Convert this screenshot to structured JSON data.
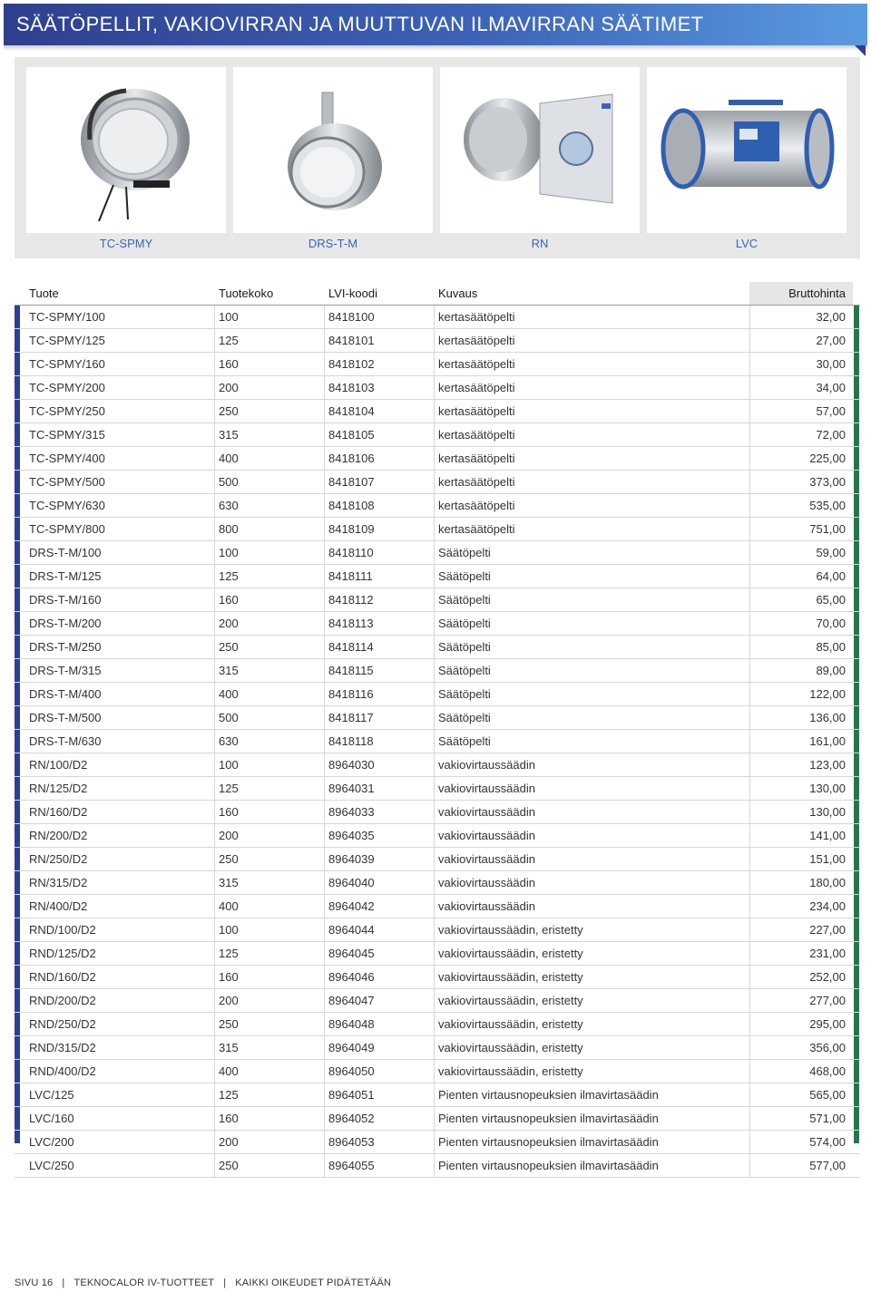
{
  "page": {
    "title": "SÄÄTÖPELLIT, VAKIOVIRRAN JA MUUTTUVAN ILMAVIRRAN SÄÄTIMET"
  },
  "products": [
    {
      "label": "TC-SPMY"
    },
    {
      "label": "DRS-T-M"
    },
    {
      "label": "RN"
    },
    {
      "label": "LVC"
    }
  ],
  "table": {
    "headers": [
      "Tuote",
      "Tuotekoko",
      "LVI-koodi",
      "Kuvaus",
      "Bruttohinta"
    ],
    "rows": [
      [
        "TC-SPMY/100",
        "100",
        "8418100",
        "kertasäätöpelti",
        "32,00"
      ],
      [
        "TC-SPMY/125",
        "125",
        "8418101",
        "kertasäätöpelti",
        "27,00"
      ],
      [
        "TC-SPMY/160",
        "160",
        "8418102",
        "kertasäätöpelti",
        "30,00"
      ],
      [
        "TC-SPMY/200",
        "200",
        "8418103",
        "kertasäätöpelti",
        "34,00"
      ],
      [
        "TC-SPMY/250",
        "250",
        "8418104",
        "kertasäätöpelti",
        "57,00"
      ],
      [
        "TC-SPMY/315",
        "315",
        "8418105",
        "kertasäätöpelti",
        "72,00"
      ],
      [
        "TC-SPMY/400",
        "400",
        "8418106",
        "kertasäätöpelti",
        "225,00"
      ],
      [
        "TC-SPMY/500",
        "500",
        "8418107",
        "kertasäätöpelti",
        "373,00"
      ],
      [
        "TC-SPMY/630",
        "630",
        "8418108",
        "kertasäätöpelti",
        "535,00"
      ],
      [
        "TC-SPMY/800",
        "800",
        "8418109",
        "kertasäätöpelti",
        "751,00"
      ],
      [
        "DRS-T-M/100",
        "100",
        "8418110",
        "Säätöpelti",
        "59,00"
      ],
      [
        "DRS-T-M/125",
        "125",
        "8418111",
        "Säätöpelti",
        "64,00"
      ],
      [
        "DRS-T-M/160",
        "160",
        "8418112",
        "Säätöpelti",
        "65,00"
      ],
      [
        "DRS-T-M/200",
        "200",
        "8418113",
        "Säätöpelti",
        "70,00"
      ],
      [
        "DRS-T-M/250",
        "250",
        "8418114",
        "Säätöpelti",
        "85,00"
      ],
      [
        "DRS-T-M/315",
        "315",
        "8418115",
        "Säätöpelti",
        "89,00"
      ],
      [
        "DRS-T-M/400",
        "400",
        "8418116",
        "Säätöpelti",
        "122,00"
      ],
      [
        "DRS-T-M/500",
        "500",
        "8418117",
        "Säätöpelti",
        "136,00"
      ],
      [
        "DRS-T-M/630",
        "630",
        "8418118",
        "Säätöpelti",
        "161,00"
      ],
      [
        "RN/100/D2",
        "100",
        "8964030",
        "vakiovirtaussäädin",
        "123,00"
      ],
      [
        "RN/125/D2",
        "125",
        "8964031",
        "vakiovirtaussäädin",
        "130,00"
      ],
      [
        "RN/160/D2",
        "160",
        "8964033",
        "vakiovirtaussäädin",
        "130,00"
      ],
      [
        "RN/200/D2",
        "200",
        "8964035",
        "vakiovirtaussäädin",
        "141,00"
      ],
      [
        "RN/250/D2",
        "250",
        "8964039",
        "vakiovirtaussäädin",
        "151,00"
      ],
      [
        "RN/315/D2",
        "315",
        "8964040",
        "vakiovirtaussäädin",
        "180,00"
      ],
      [
        "RN/400/D2",
        "400",
        "8964042",
        "vakiovirtaussäädin",
        "234,00"
      ],
      [
        "RND/100/D2",
        "100",
        "8964044",
        "vakiovirtaussäädin, eristetty",
        "227,00"
      ],
      [
        "RND/125/D2",
        "125",
        "8964045",
        "vakiovirtaussäädin, eristetty",
        "231,00"
      ],
      [
        "RND/160/D2",
        "160",
        "8964046",
        "vakiovirtaussäädin, eristetty",
        "252,00"
      ],
      [
        "RND/200/D2",
        "200",
        "8964047",
        "vakiovirtaussäädin, eristetty",
        "277,00"
      ],
      [
        "RND/250/D2",
        "250",
        "8964048",
        "vakiovirtaussäädin, eristetty",
        "295,00"
      ],
      [
        "RND/315/D2",
        "315",
        "8964049",
        "vakiovirtaussäädin, eristetty",
        "356,00"
      ],
      [
        "RND/400/D2",
        "400",
        "8964050",
        "vakiovirtaussäädin, eristetty",
        "468,00"
      ],
      [
        "LVC/125",
        "125",
        "8964051",
        "Pienten virtausnopeuksien ilmavirtasäädin",
        "565,00"
      ],
      [
        "LVC/160",
        "160",
        "8964052",
        "Pienten virtausnopeuksien ilmavirtasäädin",
        "571,00"
      ],
      [
        "LVC/200",
        "200",
        "8964053",
        "Pienten virtausnopeuksien ilmavirtasäädin",
        "574,00"
      ],
      [
        "LVC/250",
        "250",
        "8964055",
        "Pienten virtausnopeuksien ilmavirtasäädin",
        "577,00"
      ]
    ]
  },
  "footer": {
    "page": "SIVU 16",
    "company": "TEKNOCALOR IV-TUOTTEET",
    "rights": "KAIKKI OIKEUDET PIDÄTETÄÄN"
  },
  "colors": {
    "header_dark": "#2f3f8f",
    "header_light": "#5a9be0",
    "label_blue": "#3b63b5",
    "accent_green": "#1f7a4a"
  }
}
